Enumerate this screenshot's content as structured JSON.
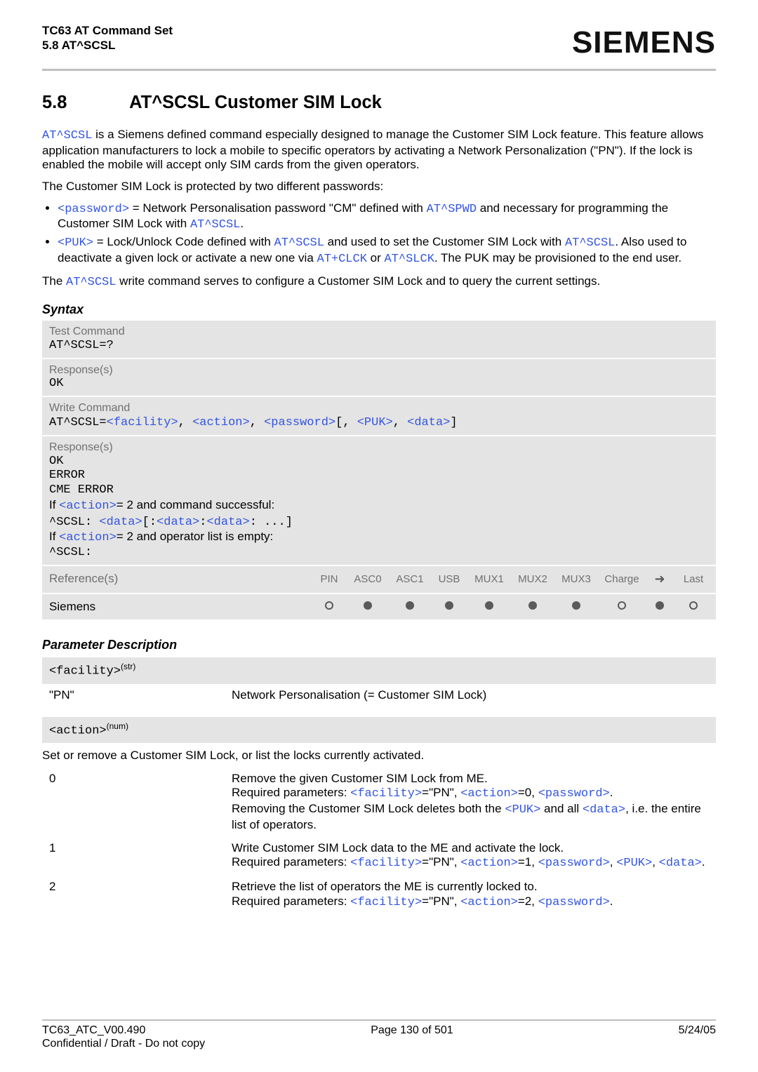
{
  "header": {
    "title": "TC63 AT Command Set",
    "subtitle": "5.8 AT^SCSL",
    "brand": "SIEMENS"
  },
  "section": {
    "number": "5.8",
    "title": "AT^SCSL   Customer SIM Lock"
  },
  "intro_p1a": "AT^SCSL",
  "intro_p1b": " is a Siemens defined command especially designed to manage the Customer SIM Lock feature. This feature allows application manufacturers to lock a mobile to specific operators by activating a Network Personalization (\"PN\"). If the lock is enabled the mobile will accept only SIM cards from the given operators.",
  "intro_p2": "The Customer SIM Lock is protected by two different passwords:",
  "bullet1": {
    "a": "<password>",
    "b": " = Network Personalisation password \"CM\" defined with ",
    "c": "AT^SPWD",
    "d": " and necessary for programming the Customer SIM Lock with ",
    "e": "AT^SCSL",
    "f": "."
  },
  "bullet2": {
    "a": "<PUK>",
    "b": " = Lock/Unlock Code defined with ",
    "c": "AT^SCSL",
    "d": " and used to set the Customer SIM Lock with ",
    "e": "AT^SCSL",
    "f": ". Also used to deactivate a given lock or activate a new one via ",
    "g": "AT+CLCK",
    "h": " or ",
    "i": "AT^SLCK",
    "j": ". The PUK may be provisioned to the end user."
  },
  "intro_p3a": "The ",
  "intro_p3b": "AT^SCSL",
  "intro_p3c": " write command serves to configure a Customer SIM Lock and to query the current settings.",
  "syntax_heading": "Syntax",
  "syntax": {
    "test_label": "Test Command",
    "test_cmd": "AT^SCSL=?",
    "test_resp_label": "Response(s)",
    "test_resp": "OK",
    "write_label": "Write Command",
    "write_cmd_pre": "AT^SCSL=",
    "write_cmd_f": "<facility>",
    "write_cmd_a": "<action>",
    "write_cmd_p": "<password>",
    "write_cmd_puk": "<PUK>",
    "write_cmd_d": "<data>",
    "write_resp_label": "Response(s)",
    "wr_ok": "OK",
    "wr_err1": "ERROR",
    "wr_err2": "CME ERROR",
    "wr_if1a": "If ",
    "wr_if1b": "<action>",
    "wr_if1c": "= 2 and command successful:",
    "wr_scsl1a": "^SCSL: ",
    "wr_scsl1b": "<data>",
    "wr_scsl1c": "[:",
    "wr_scsl1d": "<data>",
    "wr_scsl1e": ":",
    "wr_scsl1f": "<data>",
    "wr_scsl1g": ": ...]",
    "wr_if2a": "If ",
    "wr_if2b": "<action>",
    "wr_if2c": "= 2 and operator list is empty:",
    "wr_scsl2": "^SCSL:"
  },
  "avail": {
    "ref_label": "Reference(s)",
    "cols": [
      "PIN",
      "ASC0",
      "ASC1",
      "USB",
      "MUX1",
      "MUX2",
      "MUX3",
      "Charge",
      "➜",
      "Last"
    ],
    "row_name": "Siemens"
  },
  "paramdesc_heading": "Parameter Description",
  "facility": {
    "name": "<facility>",
    "sup": "(str)",
    "key": "\"PN\"",
    "val": "Network Personalisation (= Customer SIM Lock)"
  },
  "action": {
    "name": "<action>",
    "sup": "(num)",
    "lead": "Set or remove a Customer SIM Lock, or list the locks currently activated.",
    "row0": {
      "key": "0",
      "l1": "Remove the given Customer SIM Lock from ME.",
      "l2a": "Required parameters: ",
      "l2b": "<facility>",
      "l2c": "=\"PN\", ",
      "l2d": "<action>",
      "l2e": "=0, ",
      "l2f": "<password>",
      "l2g": ".",
      "l3a": "Removing the Customer SIM Lock deletes both the ",
      "l3b": "<PUK>",
      "l3c": " and all ",
      "l3d": "<data>",
      "l3e": ", i.e. the entire list of operators."
    },
    "row1": {
      "key": "1",
      "l1": "Write Customer SIM Lock data to the ME and activate the lock.",
      "l2a": "Required  parameters:  ",
      "l2b": "<facility>",
      "l2c": "=\"PN\",  ",
      "l2d": "<action>",
      "l2e": "=1,  ",
      "l2f": "<password>",
      "l2g": ", ",
      "l2h": "<PUK>",
      "l2i": ", ",
      "l2j": "<data>",
      "l2k": "."
    },
    "row2": {
      "key": "2",
      "l1": "Retrieve the list of operators the ME is currently locked to.",
      "l2a": "Required parameters: ",
      "l2b": "<facility>",
      "l2c": "=\"PN\", ",
      "l2d": "<action>",
      "l2e": "=2, ",
      "l2f": "<password>",
      "l2g": "."
    }
  },
  "footer": {
    "left1": "TC63_ATC_V00.490",
    "center": "Page 130 of 501",
    "right": "5/24/05",
    "left2": "Confidential / Draft - Do not copy"
  }
}
